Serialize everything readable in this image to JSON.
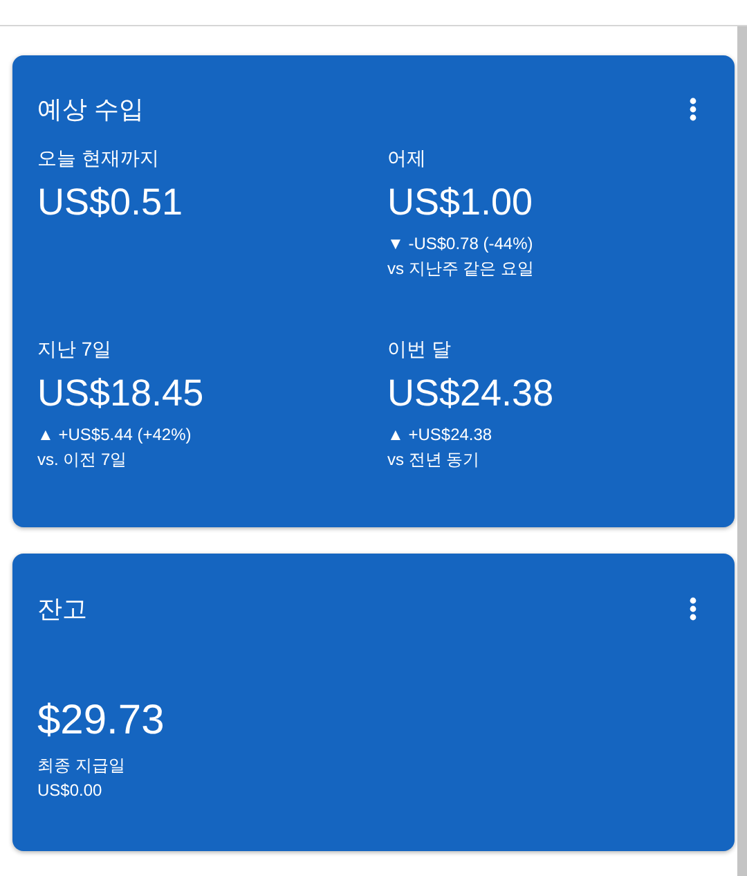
{
  "earnings_card": {
    "title": "예상 수입",
    "metrics": [
      {
        "label": "오늘 현재까지",
        "value": "US$0.51"
      },
      {
        "label": "어제",
        "value": "US$1.00",
        "change": "▼ -US$0.78 (-44%)",
        "comparison": "vs 지난주 같은 요일"
      },
      {
        "label": "지난 7일",
        "value": "US$18.45",
        "change": "▲ +US$5.44 (+42%)",
        "comparison": "vs. 이전 7일"
      },
      {
        "label": "이번 달",
        "value": "US$24.38",
        "change": "▲ +US$24.38",
        "comparison": "vs 전년 동기"
      }
    ]
  },
  "balance_card": {
    "title": "잔고",
    "value": "$29.73",
    "last_payment_label": "최종 지급일",
    "last_payment_value": "US$0.00"
  }
}
